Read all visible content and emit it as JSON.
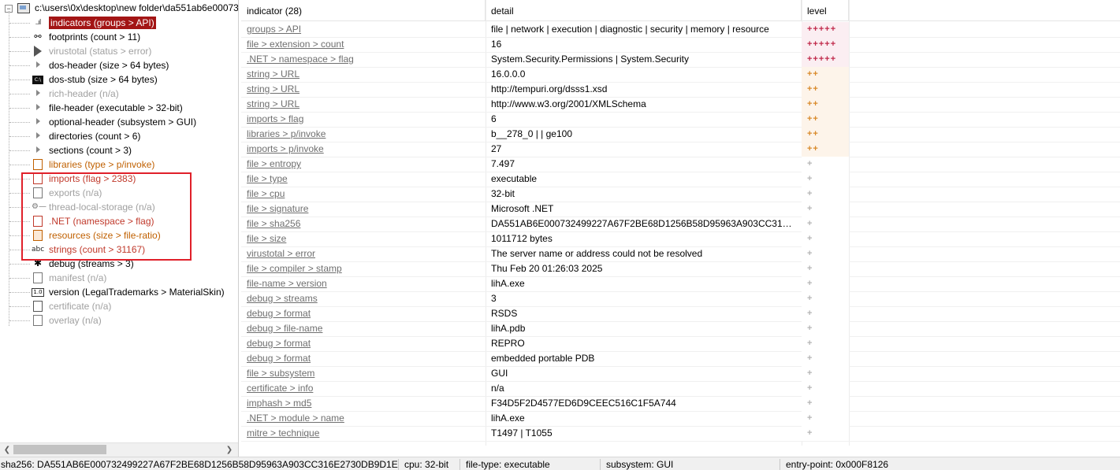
{
  "tree": {
    "root_label": "c:\\users\\0x\\desktop\\new folder\\da551ab6e00073",
    "nodes": [
      {
        "label": "indicators (groups > API)",
        "state": "selected",
        "icon": "bar-chart-icon",
        "caret": false
      },
      {
        "label": "footprints (count > 11)",
        "state": "normal",
        "icon": "footprints-icon",
        "caret": false
      },
      {
        "label": "virustotal (status > error)",
        "state": "disabled",
        "icon": "virustotal-icon",
        "caret": false
      },
      {
        "label": "dos-header (size > 64 bytes)",
        "state": "normal",
        "icon": "",
        "caret": true
      },
      {
        "label": "dos-stub (size > 64 bytes)",
        "state": "normal",
        "icon": "console-icon",
        "caret": false
      },
      {
        "label": "rich-header (n/a)",
        "state": "disabled",
        "icon": "",
        "caret": true
      },
      {
        "label": "file-header (executable > 32-bit)",
        "state": "normal",
        "icon": "",
        "caret": true
      },
      {
        "label": "optional-header (subsystem > GUI)",
        "state": "normal",
        "icon": "",
        "caret": true
      },
      {
        "label": "directories (count > 6)",
        "state": "normal",
        "icon": "",
        "caret": true
      },
      {
        "label": "sections (count > 3)",
        "state": "normal",
        "icon": "",
        "caret": true
      },
      {
        "label": "libraries (type > p/invoke)",
        "state": "warning",
        "icon": "library-icon",
        "caret": false
      },
      {
        "label": "imports (flag > 2383)",
        "state": "suspicious",
        "icon": "imports-icon",
        "caret": false
      },
      {
        "label": "exports (n/a)",
        "state": "disabled",
        "icon": "exports-icon",
        "caret": false
      },
      {
        "label": "thread-local-storage (n/a)",
        "state": "disabled",
        "icon": "key-icon",
        "caret": false
      },
      {
        "label": ".NET (namespace > flag)",
        "state": "suspicious",
        "icon": "dotnet-icon",
        "caret": false
      },
      {
        "label": "resources (size > file-ratio)",
        "state": "warning",
        "icon": "resources-icon",
        "caret": false
      },
      {
        "label": "strings (count > 31167)",
        "state": "suspicious",
        "icon": "abc-icon",
        "caret": false
      },
      {
        "label": "debug (streams > 3)",
        "state": "normal",
        "icon": "bug-icon",
        "caret": false
      },
      {
        "label": "manifest (n/a)",
        "state": "disabled",
        "icon": "manifest-icon",
        "caret": false
      },
      {
        "label": "version (LegalTrademarks > MaterialSkin)",
        "state": "normal",
        "icon": "version-icon",
        "caret": false
      },
      {
        "label": "certificate (n/a)",
        "state": "disabled",
        "icon": "certificate-icon",
        "caret": false
      },
      {
        "label": "overlay (n/a)",
        "state": "disabled",
        "icon": "overlay-icon",
        "caret": false
      }
    ]
  },
  "table": {
    "headers": {
      "indicator": "indicator (28)",
      "detail": "detail",
      "level": "level"
    },
    "rows": [
      {
        "indicator": "groups > API",
        "detail": "file | network | execution | diagnostic | security | memory | resource",
        "level": "+++++"
      },
      {
        "indicator": "file > extension > count",
        "detail": "16",
        "level": "+++++"
      },
      {
        "indicator": ".NET > namespace > flag",
        "detail": "System.Security.Permissions | System.Security",
        "level": "+++++"
      },
      {
        "indicator": "string > URL",
        "detail": "16.0.0.0",
        "level": "++"
      },
      {
        "indicator": "string > URL",
        "detail": "http://tempuri.org/dsss1.xsd",
        "level": "++"
      },
      {
        "indicator": "string > URL",
        "detail": "http://www.w3.org/2001/XMLSchema",
        "level": "++"
      },
      {
        "indicator": "imports > flag",
        "detail": "6",
        "level": "++"
      },
      {
        "indicator": "libraries > p/invoke",
        "detail": "b__278_0 | | ge100",
        "level": "++"
      },
      {
        "indicator": "imports > p/invoke",
        "detail": "27",
        "level": "++"
      },
      {
        "indicator": "file > entropy",
        "detail": "7.497",
        "level": "+"
      },
      {
        "indicator": "file > type",
        "detail": "executable",
        "level": "+"
      },
      {
        "indicator": "file > cpu",
        "detail": "32-bit",
        "level": "+"
      },
      {
        "indicator": "file > signature",
        "detail": "Microsoft .NET",
        "level": "+"
      },
      {
        "indicator": "file > sha256",
        "detail": "DA551AB6E000732499227A67F2BE68D1256B58D95963A903CC316E2730DB9D1E",
        "level": "+"
      },
      {
        "indicator": "file > size",
        "detail": "1011712 bytes",
        "level": "+"
      },
      {
        "indicator": "virustotal > error",
        "detail": "The server name or address could not be resolved",
        "level": "+"
      },
      {
        "indicator": "file > compiler > stamp",
        "detail": "Thu Feb 20 01:26:03 2025",
        "level": "+"
      },
      {
        "indicator": "file-name > version",
        "detail": "lihA.exe",
        "level": "+"
      },
      {
        "indicator": "debug > streams",
        "detail": "3",
        "level": "+"
      },
      {
        "indicator": "debug > format",
        "detail": "RSDS",
        "level": "+"
      },
      {
        "indicator": "debug > file-name",
        "detail": "lihA.pdb",
        "level": "+"
      },
      {
        "indicator": "debug > format",
        "detail": "REPRO",
        "level": "+"
      },
      {
        "indicator": "debug > format",
        "detail": "embedded portable PDB",
        "level": "+"
      },
      {
        "indicator": "file > subsystem",
        "detail": "GUI",
        "level": "+"
      },
      {
        "indicator": "certificate > info",
        "detail": "n/a",
        "level": "+"
      },
      {
        "indicator": "imphash > md5",
        "detail": "F34D5F2D4577ED6D9CEEC516C1F5A744",
        "level": "+"
      },
      {
        "indicator": ".NET > module > name",
        "detail": "lihA.exe",
        "level": "+"
      },
      {
        "indicator": "mitre > technique",
        "detail": "T1497 | T1055",
        "level": "+"
      }
    ]
  },
  "status": {
    "sha256": "sha256: DA551AB6E000732499227A67F2BE68D1256B58D95963A903CC316E2730DB9D1E",
    "cpu": "cpu: 32-bit",
    "file_type": "file-type: executable",
    "subsystem": "subsystem: GUI",
    "entry_point": "entry-point: 0x000F8126"
  },
  "colors": {
    "selected_bg": "#a31515",
    "suspicious_text": "#c0392b",
    "warning_text": "#c06000",
    "highlight_box": "#e0202a",
    "level5": "#c0294a",
    "level2": "#d98a2a"
  }
}
